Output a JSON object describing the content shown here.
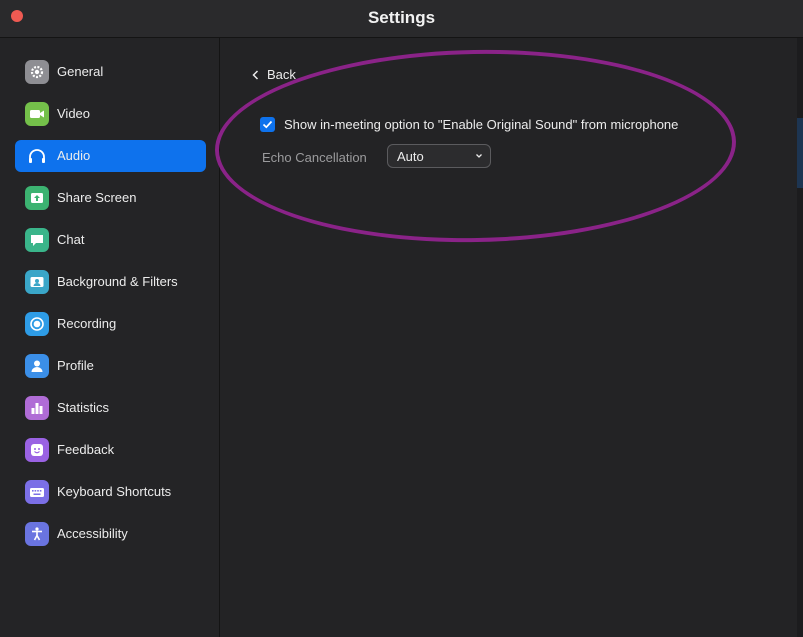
{
  "window": {
    "title": "Settings"
  },
  "sidebar": {
    "items": [
      {
        "label": "General",
        "icon": "gear-icon",
        "color": "#8e8e93"
      },
      {
        "label": "Video",
        "icon": "video-camera-icon",
        "color": "#74c04a"
      },
      {
        "label": "Audio",
        "icon": "headphones-icon",
        "color": "#0e72ed",
        "active": true
      },
      {
        "label": "Share Screen",
        "icon": "share-screen-icon",
        "color": "#3cb371"
      },
      {
        "label": "Chat",
        "icon": "chat-bubble-icon",
        "color": "#3ab58a"
      },
      {
        "label": "Background & Filters",
        "icon": "background-icon",
        "color": "#3aa6c8"
      },
      {
        "label": "Recording",
        "icon": "record-icon",
        "color": "#2e9ce6"
      },
      {
        "label": "Profile",
        "icon": "profile-icon",
        "color": "#3b8fe8"
      },
      {
        "label": "Statistics",
        "icon": "bar-chart-icon",
        "color": "#b06cd6"
      },
      {
        "label": "Feedback",
        "icon": "smiley-icon",
        "color": "#9a62e3"
      },
      {
        "label": "Keyboard Shortcuts",
        "icon": "keyboard-icon",
        "color": "#7b6fe6"
      },
      {
        "label": "Accessibility",
        "icon": "accessibility-icon",
        "color": "#6a74e0"
      }
    ]
  },
  "main": {
    "back_label": "Back",
    "original_sound_option": {
      "label": "Show in-meeting option to \"Enable Original Sound\" from microphone",
      "checked": true
    },
    "echo_cancellation": {
      "label": "Echo Cancellation",
      "value": "Auto"
    }
  },
  "colors": {
    "accent": "#0e72ed",
    "annotation": "#8a2388"
  }
}
